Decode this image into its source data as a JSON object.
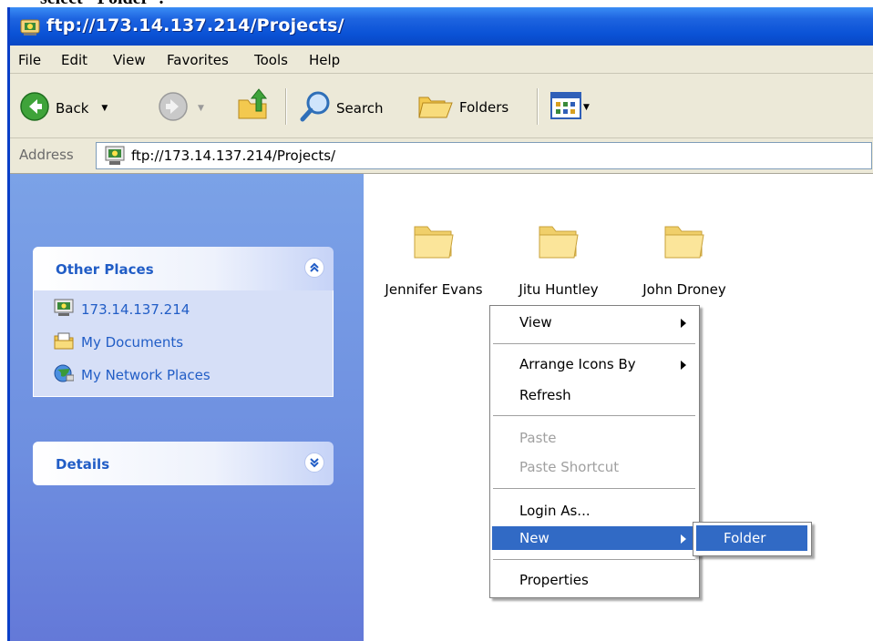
{
  "caption": "select \"Folder\".",
  "window": {
    "title": "ftp://173.14.137.214/Projects/",
    "menu": [
      "File",
      "Edit",
      "View",
      "Favorites",
      "Tools",
      "Help"
    ],
    "toolbar": {
      "back_label": "Back",
      "search_label": "Search",
      "folders_label": "Folders"
    },
    "address": {
      "label": "Address",
      "value": "ftp://173.14.137.214/Projects/"
    }
  },
  "sidebar": {
    "other_places": {
      "title": "Other Places",
      "items": [
        "173.14.137.214",
        "My Documents",
        "My Network Places"
      ]
    },
    "details": {
      "title": "Details"
    }
  },
  "folders": [
    "Jennifer Evans",
    "Jitu Huntley",
    "John Droney"
  ],
  "context_menu": {
    "items": [
      {
        "label": "View",
        "submenu": true,
        "disabled": false
      },
      {
        "label": "Arrange Icons By",
        "submenu": true,
        "disabled": false
      },
      {
        "label": "Refresh",
        "submenu": false,
        "disabled": false
      },
      {
        "label": "Paste",
        "submenu": false,
        "disabled": true
      },
      {
        "label": "Paste Shortcut",
        "submenu": false,
        "disabled": true
      },
      {
        "label": "Login As...",
        "submenu": false,
        "disabled": false
      },
      {
        "label": "New",
        "submenu": true,
        "disabled": false,
        "selected": true
      },
      {
        "label": "Properties",
        "submenu": false,
        "disabled": false
      }
    ]
  },
  "submenu": {
    "items": [
      "Folder"
    ]
  },
  "colors": {
    "title_bar": "#0a52d6",
    "highlight": "#316ac5",
    "link": "#215dc6",
    "sidebar": "#6e8fe0"
  }
}
